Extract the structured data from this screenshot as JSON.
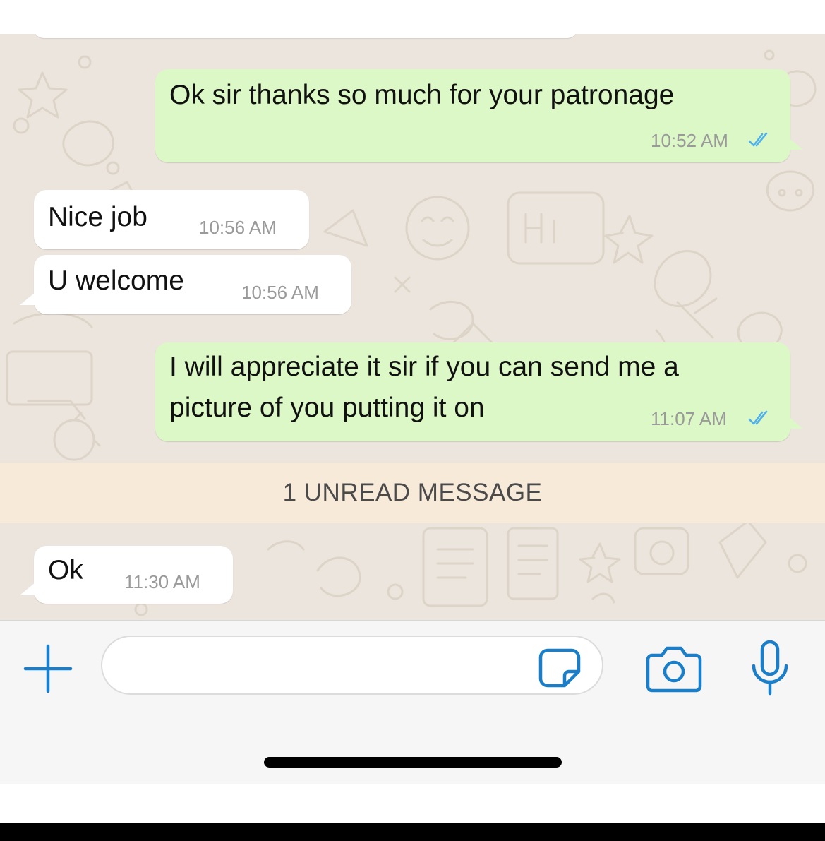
{
  "colors": {
    "outgoing_bubble": "#dcf8c6",
    "incoming_bubble": "#ffffff",
    "chat_background": "#ece5dd",
    "unread_bar": "#f8ead9",
    "read_ticks": "#4fb0ec",
    "accent_icons": "#1a7ec9"
  },
  "messages": [
    {
      "direction": "outgoing",
      "text": "Ok sir thanks so much for your patronage",
      "time": "10:52 AM",
      "status": "read"
    },
    {
      "direction": "incoming",
      "text": "Nice job",
      "time": "10:56 AM"
    },
    {
      "direction": "incoming",
      "text": "U welcome",
      "time": "10:56 AM"
    },
    {
      "direction": "outgoing",
      "text_line1": "I will appreciate it sir if you can send me a",
      "text_line2": "picture of you putting it on",
      "time": "11:07 AM",
      "status": "read"
    },
    {
      "direction": "incoming",
      "text": "Ok",
      "time": "11:30 AM"
    }
  ],
  "unread_divider": {
    "label": "1 UNREAD MESSAGE"
  },
  "composer": {
    "input_value": "",
    "icons": {
      "attach": "plus-icon",
      "sticker": "sticker-icon",
      "camera": "camera-icon",
      "mic": "microphone-icon"
    }
  }
}
